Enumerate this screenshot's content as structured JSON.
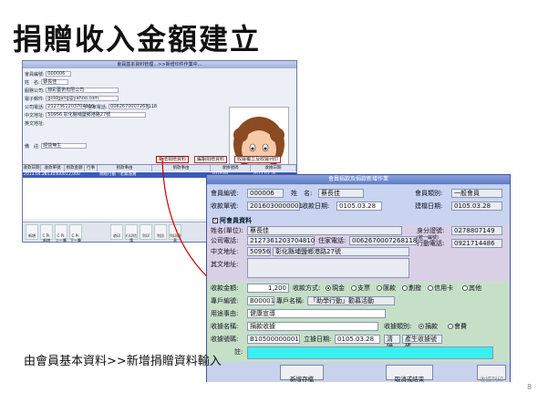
{
  "slide": {
    "title": "捐贈收入金額建立",
    "caption": "由會員基本資料>>新增捐贈資料輸入",
    "page_number": "8"
  },
  "back_window": {
    "title": "會員基本資料管理…>>新增印件作業中…",
    "fields": [
      {
        "label": "會員編號:",
        "value": "000006"
      },
      {
        "label": "姓　名:",
        "value": "蔡長佳"
      },
      {
        "label": "服務公司:",
        "value": "綠彩藝術有限公司"
      },
      {
        "label": "電子郵件:",
        "value": "goldgang@yahoo.com"
      },
      {
        "label": "公司電話:",
        "value": "2127361203704810"
      },
      {
        "label": "住家電話:",
        "value": "0062670007268118"
      },
      {
        "label": "中文地址:",
        "value": "50956 彰化縣埔鹽鄉港路27號"
      },
      {
        "label": "英文地址:",
        "value": ""
      },
      {
        "label": "備　註:",
        "value": "經營無生"
      }
    ],
    "buttons": [
      "新增捐贈資料",
      "編輯捐贈資料",
      "收據獨立及收據列印"
    ],
    "grid_headers": [
      "收款日期",
      "收款單號",
      "捐款金額",
      "行事",
      "捐款事由",
      "",
      "捐款事由",
      "收據號碼",
      "收據日期"
    ],
    "grid_row": [
      "2013.04.26",
      "2013040001",
      "2,000",
      "",
      "捐贈行動「老無落實",
      "",
      "",
      "B10500",
      "2013.03.26"
    ],
    "toolbar": [
      "新增",
      "C.Pr.新增",
      "C.Pr.上一筆",
      "C.Pr.下一筆",
      "",
      "收印",
      "行印信箋",
      "列印",
      "利訊",
      "列印捐表"
    ]
  },
  "form": {
    "title": "會員捐款及捐款新增作業",
    "member_no_label": "會員編號:",
    "member_no": "000006",
    "name_label": "姓　名:",
    "name": "蔡長佳",
    "member_type_label": "會員類別:",
    "member_type": "一般會員",
    "receipt_no_label": "收款單號:",
    "receipt_no": "2016030000001",
    "receipt_date_label": "收款日期:",
    "receipt_date": "0105.03.28",
    "create_date_label": "建檔日期:",
    "create_date": "0105.03.28",
    "member_info_label": "阿會員資料",
    "company_label": "姓名(單位):",
    "company": "蔡長佳",
    "company_phone_label": "公司電話:",
    "company_phone": "2127361203704810",
    "home_phone_label": "住家電話:",
    "home_phone": "0062670007268118",
    "id_label": "身分證號:",
    "id_label_sub": "(統一編號)",
    "id_no": "0278807149",
    "mobile_label": "行動電話:",
    "mobile": "0921714486",
    "addr_label": "中文地址:",
    "zip": "50956",
    "address": "彰化縣埔鹽鄉港路27號",
    "other_addr_label": "其文地址:",
    "amount_label": "收款金額:",
    "amount": "1,200",
    "method_label": "收款方式:",
    "methods": [
      "現金",
      "支票",
      "匯款",
      "劃撥",
      "信用卡",
      "其他"
    ],
    "project_no_label": "專戶編號:",
    "project_no": "B00001",
    "project_name_label": "專戶名稱:",
    "project_name": "「助學行動」勸募活動",
    "purpose_label": "用途事由:",
    "purpose": "健康宣導",
    "receipt_name_label": "收據名稱:",
    "receipt_name": "捐款收據",
    "receipt_type_label": "收據類別:",
    "receipt_types": [
      "捐款",
      "會費"
    ],
    "receipt_code_label": "收據號碼:",
    "receipt_code": "B10500000001",
    "issue_date_label": "立據日期:",
    "issue_date": "0105.03.28",
    "clear_label": "清除",
    "gen_label": "產生收據號碼",
    "note_label": "註:",
    "note": "",
    "btn_save": "新增存檔",
    "btn_cancel": "取消或結束",
    "btn_print": "收據列印"
  }
}
